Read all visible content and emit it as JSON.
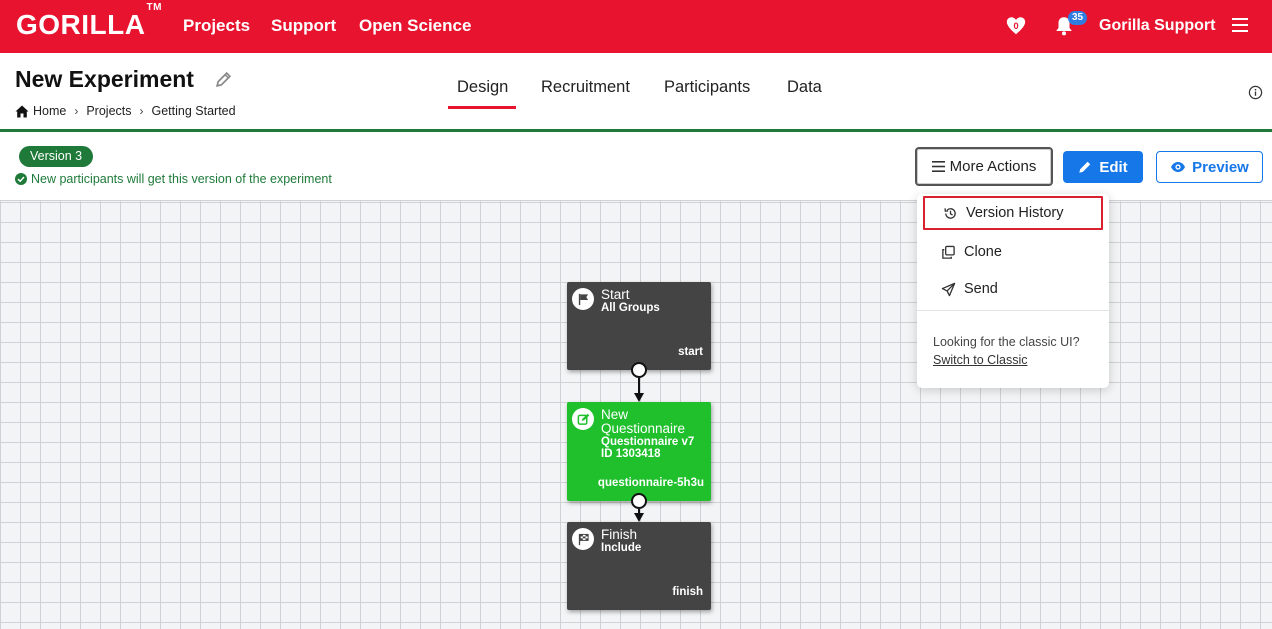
{
  "topbar": {
    "logo": "GORILLA",
    "logo_tm": "TM",
    "nav": [
      "Projects",
      "Support",
      "Open Science"
    ],
    "heart_count": "0",
    "notification_count": "35",
    "user_name": "Gorilla Support",
    "color": "#e8142f"
  },
  "header": {
    "title": "New Experiment",
    "breadcrumb": [
      "Home",
      "Projects",
      "Getting Started"
    ],
    "tabs": [
      "Design",
      "Recruitment",
      "Participants",
      "Data"
    ],
    "active_tab": "Design"
  },
  "version": {
    "badge": "Version 3",
    "note": "New participants will get this version of the experiment"
  },
  "toolbar": {
    "more_actions": "More Actions",
    "edit": "Edit",
    "preview": "Preview"
  },
  "dropdown": {
    "items": [
      "Version History",
      "Clone",
      "Send"
    ],
    "highlighted": "Version History",
    "classic_prompt": "Looking for the classic UI?",
    "classic_link": "Switch to Classic"
  },
  "nodes": [
    {
      "title": "Start",
      "sub1": "All Groups",
      "sub2": "",
      "footer": "start",
      "icon": "flag-icon",
      "color": "#444444"
    },
    {
      "title": "New Questionnaire",
      "sub1": "Questionnaire v7",
      "sub2": "ID 1303418",
      "footer": "questionnaire-5h3u",
      "icon": "edit-square-icon",
      "color": "#1fc02c"
    },
    {
      "title": "Finish",
      "sub1": "Include",
      "sub2": "",
      "footer": "finish",
      "icon": "checkered-flag-icon",
      "color": "#444444"
    }
  ]
}
